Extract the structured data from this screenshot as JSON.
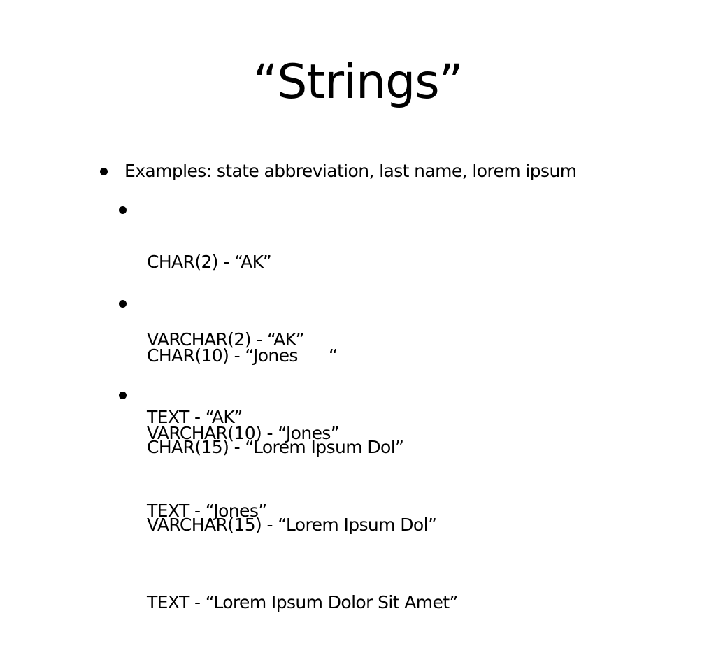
{
  "slide": {
    "title": "“Strings”",
    "main_bullet": {
      "text_prefix": "Examples: state abbreviation, last name, ",
      "text_underlined": "lorem ipsum"
    },
    "sub_bullets": [
      {
        "lines": [
          "CHAR(2) - “AK”",
          "VARCHAR(2) - “AK”",
          "TEXT - “AK”"
        ]
      },
      {
        "lines": [
          "CHAR(10) - “Jones      “",
          "VARCHAR(10) - “Jones”",
          "TEXT - “Jones”"
        ]
      },
      {
        "lines": [
          "CHAR(15) - “Lorem Ipsum Dol”",
          "VARCHAR(15) - “Lorem Ipsum Dol”",
          "TEXT - “Lorem Ipsum Dolor Sit Amet”"
        ]
      }
    ],
    "colors": {
      "background": "#ffffff",
      "text": "#000000"
    }
  }
}
